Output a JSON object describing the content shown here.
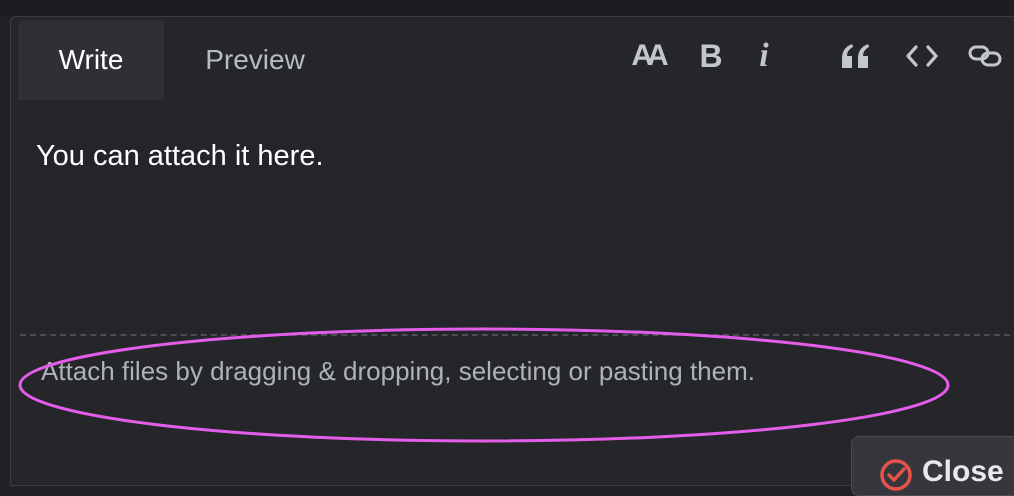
{
  "tabs": {
    "write": "Write",
    "preview": "Preview"
  },
  "toolbar": {
    "icons": [
      "text-size-icon",
      "bold-icon",
      "italic-icon",
      "quote-icon",
      "code-icon",
      "link-icon"
    ],
    "heading_glyph": "AA",
    "bold_glyph": "B",
    "italic_glyph": "i"
  },
  "editor": {
    "text": "You can attach it here."
  },
  "attach_hint": "Attach files by dragging & dropping, selecting or pasting them.",
  "close_button": {
    "label": "Close"
  },
  "colors": {
    "highlight": "#e45de8",
    "close_icon": "#e5534b"
  }
}
